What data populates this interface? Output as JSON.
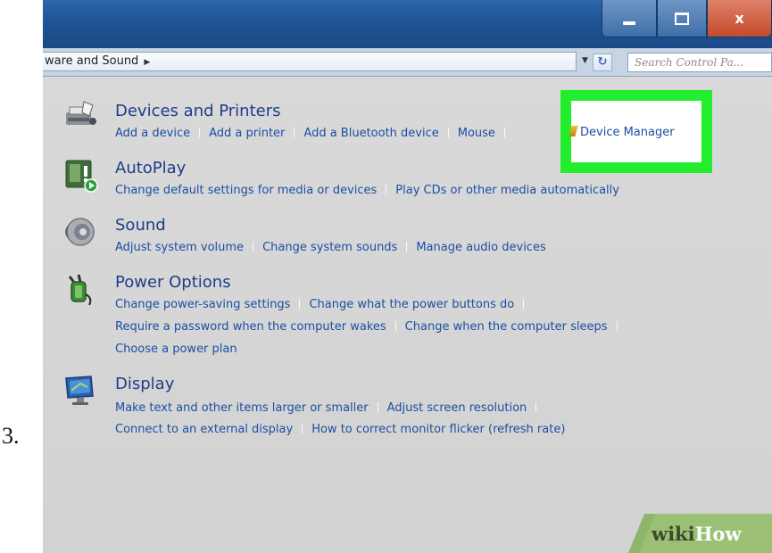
{
  "step_number": "3.",
  "window": {
    "controls": {
      "minimize": "minimize",
      "maximize": "maximize",
      "close": "x"
    }
  },
  "address": {
    "breadcrumb": "ware and Sound",
    "search_placeholder": "Search Control Pa..."
  },
  "categories": [
    {
      "title": "Devices and Printers",
      "icon": "printer-icon",
      "links": [
        "Add a device",
        "Add a printer",
        "Add a Bluetooth device",
        "Mouse"
      ]
    },
    {
      "title": "AutoPlay",
      "icon": "autoplay-icon",
      "links": [
        "Change default settings for media or devices",
        "Play CDs or other media automatically"
      ]
    },
    {
      "title": "Sound",
      "icon": "speaker-icon",
      "links": [
        "Adjust system volume",
        "Change system sounds",
        "Manage audio devices"
      ]
    },
    {
      "title": "Power Options",
      "icon": "power-plug-icon",
      "links": [
        "Change power-saving settings",
        "Change what the power buttons do",
        "Require a password when the computer wakes",
        "Change when the computer sleeps",
        "Choose a power plan"
      ]
    },
    {
      "title": "Display",
      "icon": "monitor-icon",
      "links": [
        "Make text and other items larger or smaller",
        "Adjust screen resolution",
        "Connect to an external display",
        "How to correct monitor flicker (refresh rate)"
      ]
    }
  ],
  "highlighted": {
    "label": "Device Manager",
    "highlight_color": "#23ee2e"
  },
  "watermark": {
    "wiki": "wiki",
    "how": "How"
  },
  "colors": {
    "link": "#1a4fa3",
    "heading": "#1f3c88",
    "titlebar": "#1f5597",
    "close": "#c44a2c"
  }
}
